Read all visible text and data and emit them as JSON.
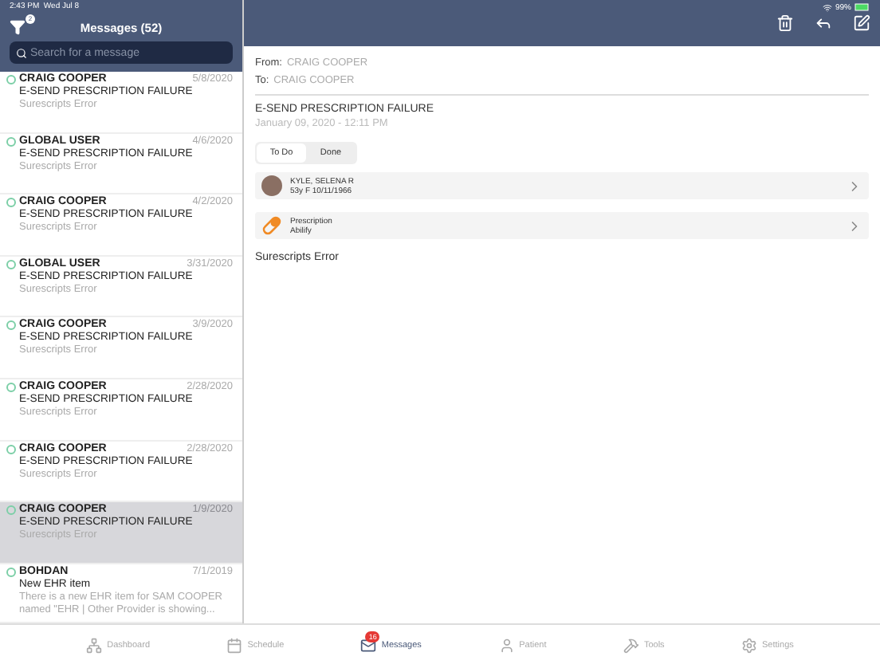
{
  "status_bar": {
    "time": "2:43 PM",
    "date": "Wed Jul 8",
    "battery": "99%"
  },
  "sidebar": {
    "filter_badge": "2",
    "title": "Messages (52)",
    "search": {
      "placeholder": "Search for a message"
    },
    "messages": [
      {
        "sender": "CRAIG COOPER",
        "date": "5/8/2020",
        "subject": "E-SEND PRESCRIPTION FAILURE",
        "preview": "Surescripts Error",
        "selected": false
      },
      {
        "sender": "GLOBAL USER",
        "date": "4/6/2020",
        "subject": "E-SEND PRESCRIPTION FAILURE",
        "preview": "Surescripts Error",
        "selected": false
      },
      {
        "sender": "CRAIG COOPER",
        "date": "4/2/2020",
        "subject": "E-SEND PRESCRIPTION FAILURE",
        "preview": "Surescripts Error",
        "selected": false
      },
      {
        "sender": "GLOBAL USER",
        "date": "3/31/2020",
        "subject": "E-SEND PRESCRIPTION FAILURE",
        "preview": "Surescripts Error",
        "selected": false
      },
      {
        "sender": "CRAIG COOPER",
        "date": "3/9/2020",
        "subject": "E-SEND PRESCRIPTION FAILURE",
        "preview": "Surescripts Error",
        "selected": false
      },
      {
        "sender": "CRAIG COOPER",
        "date": "2/28/2020",
        "subject": "E-SEND PRESCRIPTION FAILURE",
        "preview": "Surescripts Error",
        "selected": false
      },
      {
        "sender": "CRAIG COOPER",
        "date": "2/28/2020",
        "subject": "E-SEND PRESCRIPTION FAILURE",
        "preview": "Surescripts Error",
        "selected": false
      },
      {
        "sender": "CRAIG COOPER",
        "date": "1/9/2020",
        "subject": "E-SEND PRESCRIPTION FAILURE",
        "preview": "Surescripts Error",
        "selected": true
      },
      {
        "sender": "BOHDAN",
        "date": "7/1/2019",
        "subject": "New EHR item",
        "preview": "There is a new EHR item for SAM COOPER named \"EHR | Other Provider is showing...",
        "selected": false
      }
    ]
  },
  "detail": {
    "from_label": "From:",
    "from": "CRAIG COOPER",
    "to_label": "To:",
    "to": "CRAIG COOPER",
    "subject": "E-SEND PRESCRIPTION FAILURE",
    "datetime": "January 09, 2020 - 12:11 PM",
    "segments": [
      {
        "label": "To Do",
        "selected": true
      },
      {
        "label": "Done",
        "selected": false
      }
    ],
    "links": [
      {
        "kind": "patient",
        "title": "KYLE, SELENA R",
        "subtitle": "53y F 10/11/1966"
      },
      {
        "kind": "prescription",
        "title": "Prescription",
        "subtitle": "Abilify"
      }
    ],
    "body": "Surescripts Error"
  },
  "tab_bar": [
    {
      "label": "Dashboard",
      "selected": false
    },
    {
      "label": "Schedule",
      "selected": false
    },
    {
      "label": "Messages",
      "selected": true,
      "badge": "16"
    },
    {
      "label": "Patient",
      "selected": false
    },
    {
      "label": "Tools",
      "selected": false
    },
    {
      "label": "Settings",
      "selected": false
    }
  ]
}
